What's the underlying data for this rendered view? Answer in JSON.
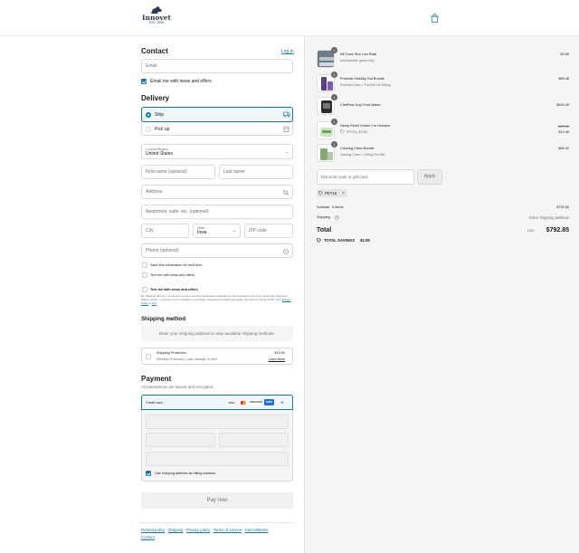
{
  "header": {
    "brand": "Innovet",
    "est": "EST. 2005"
  },
  "contact": {
    "title": "Contact",
    "login_link": "Log in",
    "email_placeholder": "Email",
    "news_checkbox_label": "Email me with news and offers"
  },
  "delivery": {
    "title": "Delivery",
    "ship_label": "Ship",
    "pickup_label": "Pick up",
    "country_label": "Country/Region",
    "country_value": "United States",
    "first_name_placeholder": "First name (optional)",
    "last_name_placeholder": "Last name",
    "address_placeholder": "Address",
    "apartment_placeholder": "Apartment, suite, etc. (optional)",
    "city_placeholder": "City",
    "state_label": "State",
    "state_value": "Iowa",
    "zip_placeholder": "ZIP code",
    "phone_placeholder": "Phone (optional)",
    "save_info_label": "Save this information for next time",
    "text_me_label": "Text me with news and offers",
    "text_me_bold_label": "Text me with news and offers",
    "disclaimer": "By checking this box I consent to receive recurring automated marketing by text message through an automatic telephone dialing system. Consent is not a condition to purchase. Message and Data rate apply. Opt Out by texting STOP. View",
    "privacy_link": "Privacy Policy",
    "and_text": "&",
    "tos_link": "ToS"
  },
  "shipping_method": {
    "title": "Shipping method",
    "placeholder_text": "Enter your shipping address to view available shipping methods.",
    "protection_title": "Shipping Protection",
    "protection_desc": "Effortless Protection | Loss, damage, or theft",
    "protection_price": "$15.99",
    "learn_more": "Learn More"
  },
  "payment": {
    "title": "Payment",
    "subtitle": "All transactions are secure and encrypted.",
    "credit_card_label": "Credit card",
    "card_brands": [
      "VISA",
      "",
      "DISCOVER",
      "AMEX",
      "+5"
    ],
    "billing_checkbox_label": "Use shipping address as billing address",
    "pay_button": "Pay now"
  },
  "footer": {
    "links": [
      "Refund policy",
      "Shipping",
      "Privacy policy",
      "Terms of service",
      "Cancellations",
      "Contact"
    ]
  },
  "summary": {
    "items": [
      {
        "name": "Kill Dock Sea Lion Rails",
        "variant": "Unshakeable (parts only)",
        "qty": "1",
        "price": "$3.50",
        "compare": "",
        "discounted": ""
      },
      {
        "name": "Probiotic Healthy Gut Bundle",
        "variant": "Probiotic Chew + PurCBD Oil 250mg",
        "qty": "1",
        "price": "$65.48",
        "compare": "",
        "discounted": ""
      },
      {
        "name": "ChefPaw Dog Food Maker",
        "variant": "",
        "qty": "1",
        "price": "$649.00",
        "compare": "",
        "discounted": ""
      },
      {
        "name": "Hemp Relief Cream For Humans",
        "variant": "PET15 (-$2.55)",
        "qty": "1",
        "price": "$14.45",
        "compare": "$17.00",
        "discounted": "true"
      },
      {
        "name": "Calming Chew Bundle",
        "variant": "Calming Chew + 125mg PurCBD",
        "qty": "1",
        "price": "$60.42",
        "compare": "",
        "discounted": ""
      }
    ],
    "discount_placeholder": "Discount code or gift card",
    "apply_button": "Apply",
    "applied_code": "PET15",
    "subtotal_label": "Subtotal · 5 items",
    "subtotal_value": "$792.85",
    "shipping_label": "Shipping",
    "shipping_value": "Enter shipping address",
    "total_label": "Total",
    "currency": "USD",
    "total_value": "$792.85",
    "savings_label": "TOTAL SAVINGS",
    "savings_value": "$2.55"
  }
}
